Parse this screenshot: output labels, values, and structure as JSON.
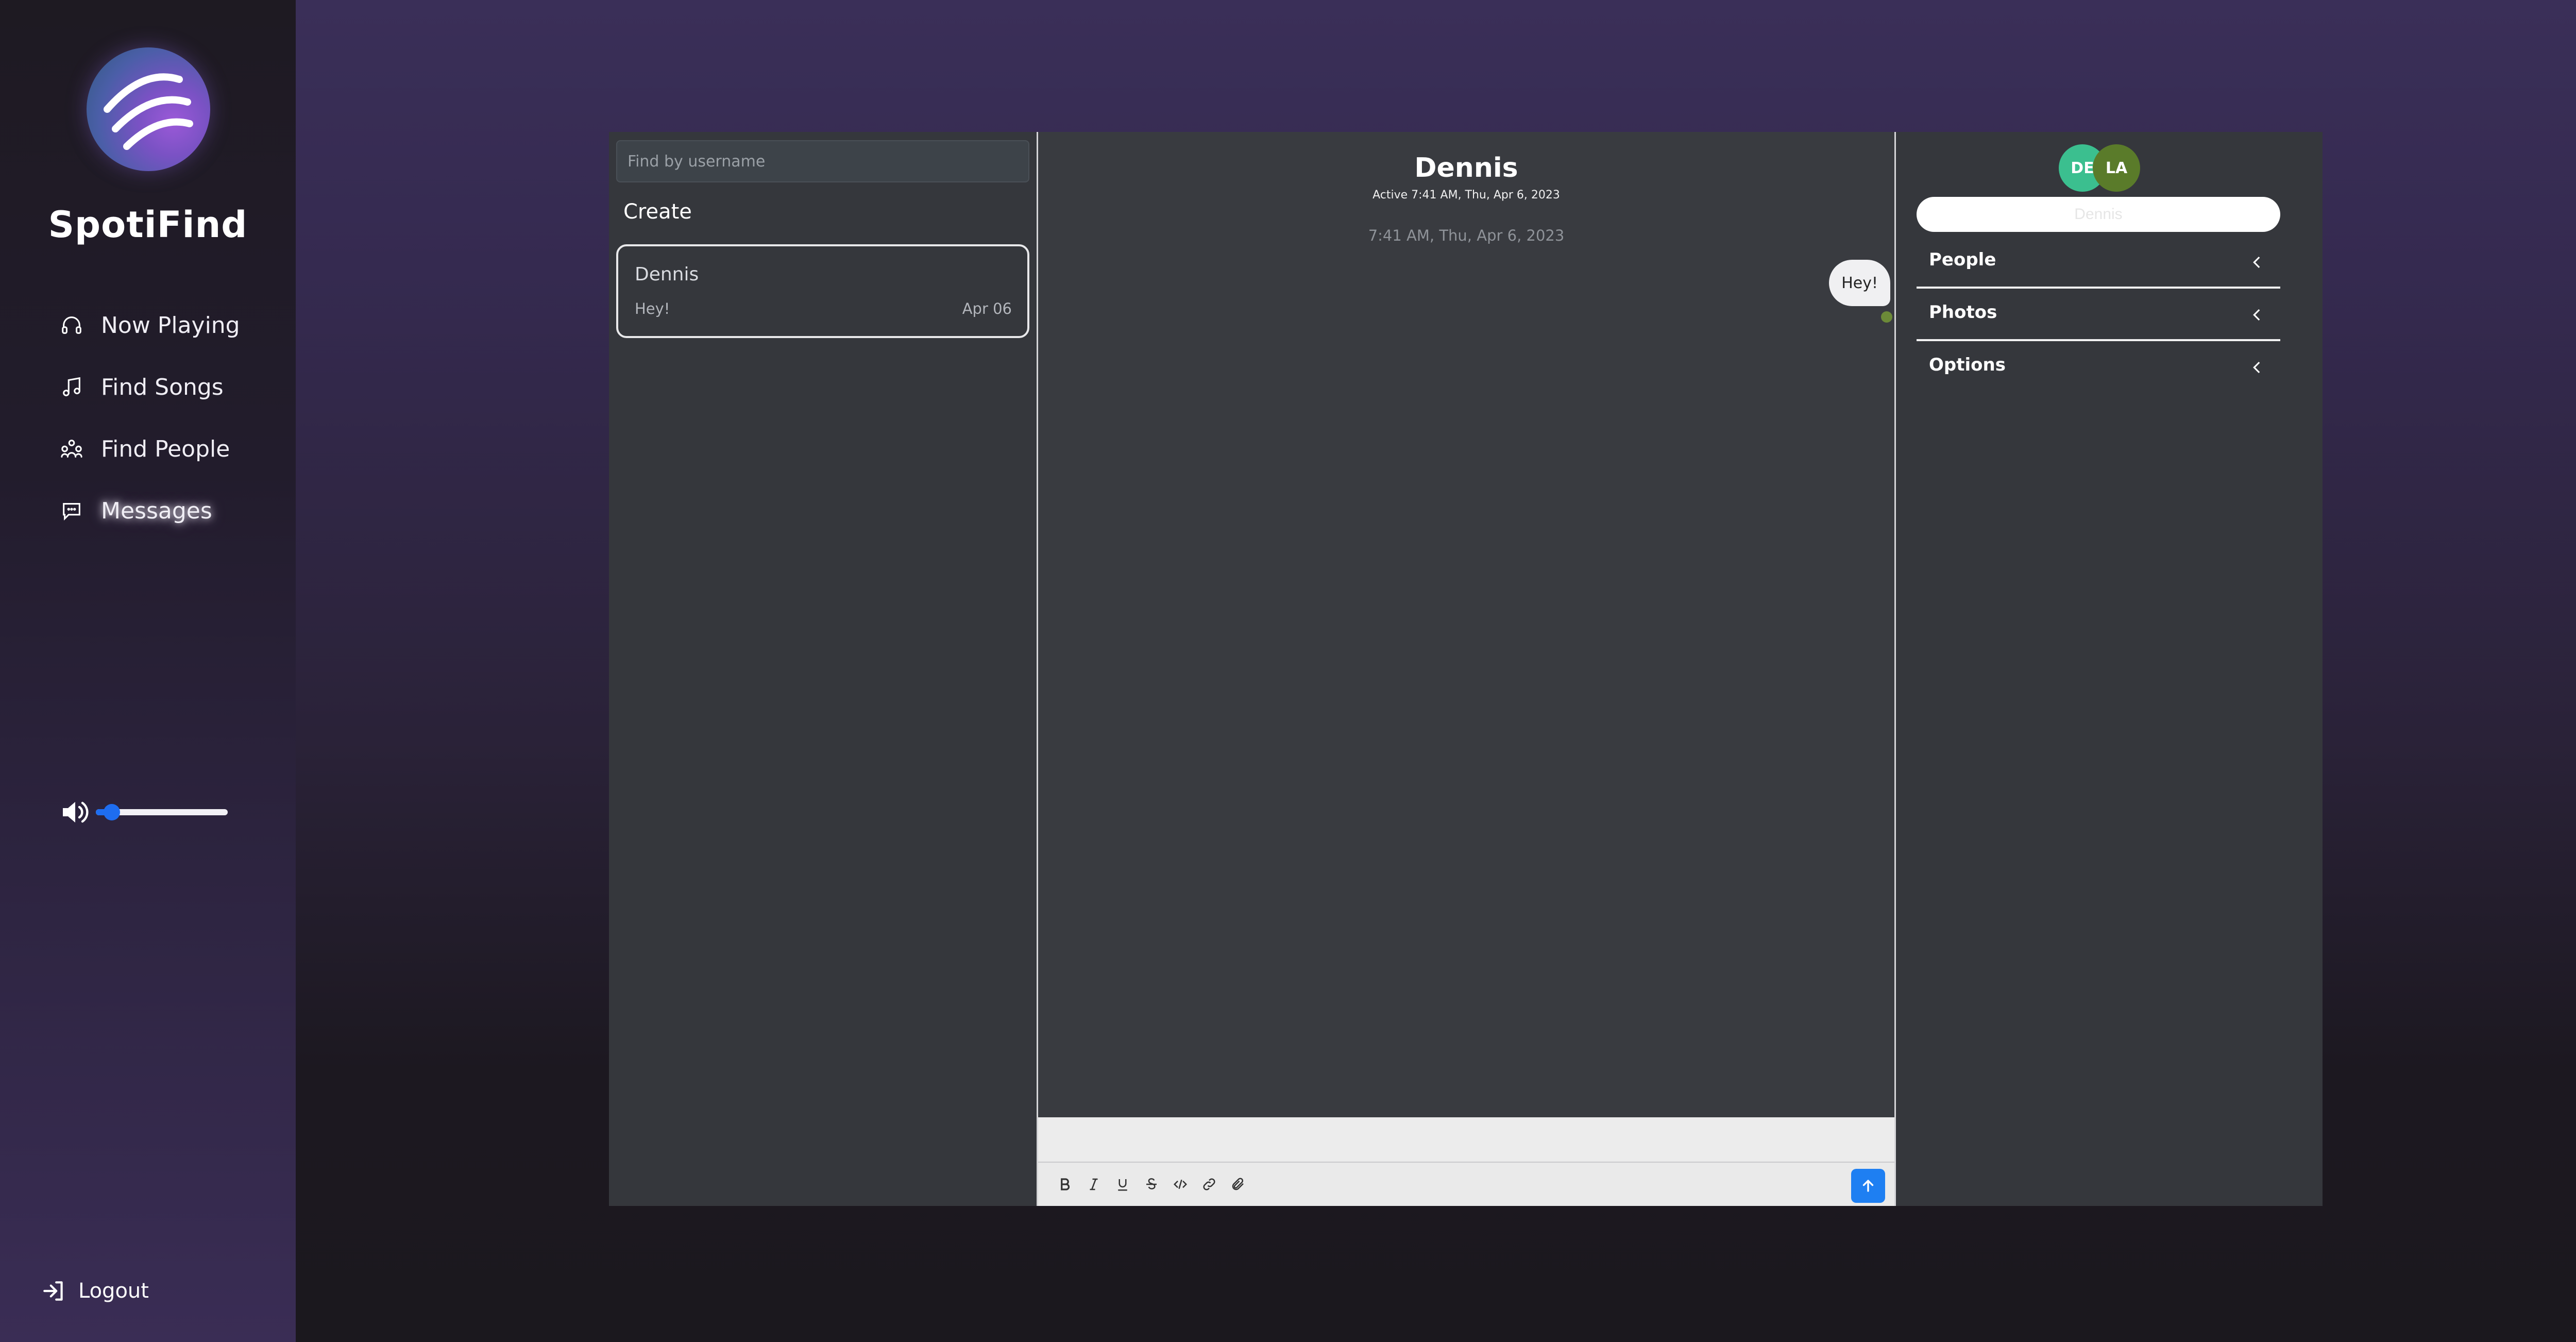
{
  "app": {
    "name": "SpotiFind"
  },
  "sidebar": {
    "nav": [
      {
        "label": "Now Playing",
        "icon": "headphones-icon"
      },
      {
        "label": "Find Songs",
        "icon": "music-note-icon"
      },
      {
        "label": "Find People",
        "icon": "people-icon"
      },
      {
        "label": "Messages",
        "icon": "chat-bubble-icon",
        "active": true
      }
    ],
    "volume": {
      "level": 0.12,
      "icon": "speaker-icon"
    },
    "logout_label": "Logout"
  },
  "conversations": {
    "search_placeholder": "Find by username",
    "create_label": "Create",
    "items": [
      {
        "name": "Dennis",
        "snippet": "Hey!",
        "date": "Apr 06"
      }
    ]
  },
  "conversation": {
    "name": "Dennis",
    "status": "Active 7:41 AM, Thu, Apr 6, 2023",
    "timestamp": "7:41 AM, Thu, Apr 6, 2023",
    "messages": [
      {
        "text": "Hey!",
        "outgoing": true
      }
    ],
    "composer": {
      "tools": [
        "bold-icon",
        "italic-icon",
        "underline-icon",
        "strikethrough-icon",
        "code-icon",
        "link-icon",
        "attachment-icon"
      ],
      "send_icon": "arrow-up-icon"
    }
  },
  "info": {
    "avatars": [
      {
        "initials": "DE",
        "color": "#3bbf8f"
      },
      {
        "initials": "LA",
        "color": "#5a7b2a"
      }
    ],
    "name_value": "Dennis",
    "sections": [
      {
        "title": "People"
      },
      {
        "title": "Photos"
      },
      {
        "title": "Options"
      }
    ]
  },
  "colors": {
    "accent": "#1e7ff2",
    "panel": "#35373c",
    "read_dot": "#6c8a38"
  }
}
